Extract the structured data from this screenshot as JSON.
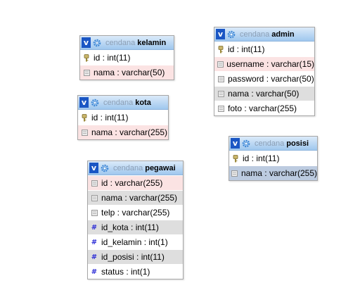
{
  "tables": [
    {
      "key": "kelamin",
      "db": "cendana",
      "name": "kelamin",
      "columns": [
        {
          "text": "id : int(11)",
          "icon": "key",
          "shade": "white"
        },
        {
          "text": "nama : varchar(50)",
          "icon": "field",
          "shade": "pink"
        }
      ]
    },
    {
      "key": "admin",
      "db": "cendana",
      "name": "admin",
      "columns": [
        {
          "text": "id : int(11)",
          "icon": "key",
          "shade": "white"
        },
        {
          "text": "username : varchar(15)",
          "icon": "field",
          "shade": "pink"
        },
        {
          "text": "password : varchar(50)",
          "icon": "field",
          "shade": "white"
        },
        {
          "text": "nama : varchar(50)",
          "icon": "field",
          "shade": "grey"
        },
        {
          "text": "foto : varchar(255)",
          "icon": "field",
          "shade": "white"
        }
      ]
    },
    {
      "key": "kota",
      "db": "cendana",
      "name": "kota",
      "columns": [
        {
          "text": "id : int(11)",
          "icon": "key",
          "shade": "white"
        },
        {
          "text": "nama : varchar(255)",
          "icon": "field",
          "shade": "pink"
        }
      ]
    },
    {
      "key": "posisi",
      "db": "cendana",
      "name": "posisi",
      "columns": [
        {
          "text": "id : int(11)",
          "icon": "key",
          "shade": "white"
        },
        {
          "text": "nama : varchar(255)",
          "icon": "field",
          "shade": "blue"
        }
      ]
    },
    {
      "key": "pegawai",
      "db": "cendana",
      "name": "pegawai",
      "columns": [
        {
          "text": "id : varchar(255)",
          "icon": "field",
          "shade": "pink"
        },
        {
          "text": "nama : varchar(255)",
          "icon": "field",
          "shade": "grey"
        },
        {
          "text": "telp : varchar(255)",
          "icon": "field",
          "shade": "white"
        },
        {
          "text": "id_kota : int(11)",
          "icon": "hash",
          "shade": "grey"
        },
        {
          "text": "id_kelamin : int(1)",
          "icon": "hash",
          "shade": "white"
        },
        {
          "text": "id_posisi : int(11)",
          "icon": "hash",
          "shade": "grey"
        },
        {
          "text": "status : int(1)",
          "icon": "hash",
          "shade": "white"
        }
      ]
    }
  ]
}
